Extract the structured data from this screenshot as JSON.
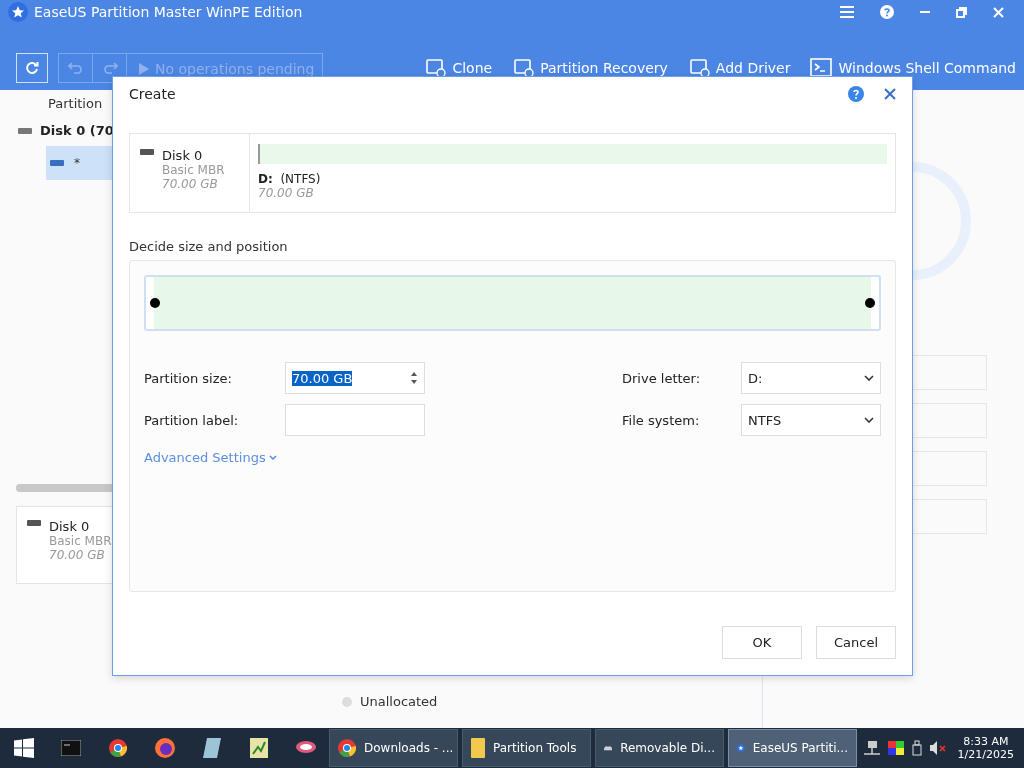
{
  "window": {
    "title": "EaseUS Partition Master WinPE Edition"
  },
  "toolbar": {
    "status": "No operations pending",
    "disabled": true,
    "actions": [
      "Clone",
      "Partition Recovery",
      "Add Driver",
      "Windows Shell Command"
    ]
  },
  "background": {
    "column_header": "Partition",
    "disk_row": "Disk 0 (70",
    "partition_row": {
      "label": "*",
      "selected": true
    },
    "disk_card": {
      "name": "Disk 0",
      "type": "Basic MBR",
      "size": "70.00 GB"
    },
    "legend": "Unallocated"
  },
  "dialog": {
    "title": "Create",
    "disk": {
      "name": "Disk 0",
      "type": "Basic MBR",
      "size": "70.00 GB"
    },
    "partition": {
      "letter": "D:",
      "fs": "(NTFS)",
      "size": "70.00 GB"
    },
    "section_title": "Decide size and position",
    "slider": {
      "level": 1
    },
    "fields": [
      {
        "label": "Partition size:",
        "kind": "spin",
        "value": "70.00 GB"
      },
      {
        "label": "Drive letter:",
        "kind": "select",
        "value": "D:"
      },
      {
        "label": "Partition label:",
        "kind": "text"
      },
      {
        "label": "File system:",
        "kind": "select",
        "value": "NTFS"
      }
    ],
    "advanced": "Advanced Settings",
    "buttons": [
      "OK",
      "Cancel"
    ]
  },
  "taskbar": {
    "tasks": [
      {
        "label": "Downloads - ...",
        "selected": false
      },
      {
        "label": "Partition Tools",
        "selected": false
      },
      {
        "label": "Removable Di...",
        "selected": false
      },
      {
        "label": "EaseUS Partiti...",
        "selected": true
      }
    ],
    "time": "8:33 AM",
    "date": "1/21/2025"
  }
}
